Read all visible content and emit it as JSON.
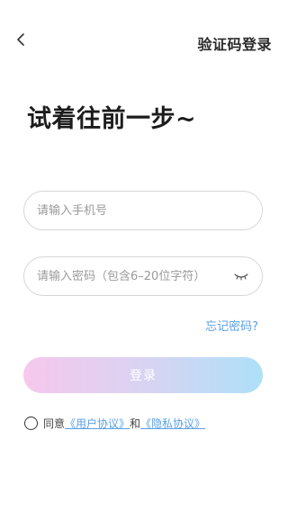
{
  "header": {
    "back_icon": "chevron-left-icon",
    "verify_login_label": "验证码登录"
  },
  "headline": "试着往前一步~",
  "form": {
    "phone_placeholder": "请输入手机号",
    "phone_value": "",
    "password_placeholder": "请输入密码（包含6–20位字符）",
    "password_value": "",
    "eye_icon": "eye-closed-icon",
    "forgot_password": "忘记密码?",
    "login_label": "登录"
  },
  "agreement": {
    "checked": false,
    "prefix": "同意",
    "user_agreement": "《用户协议》",
    "and": "和",
    "privacy_agreement": "《隐私协议》"
  },
  "colors": {
    "link": "#5aa0e8",
    "gradient_start": "#f6c8ec",
    "gradient_end": "#aee0f8"
  }
}
